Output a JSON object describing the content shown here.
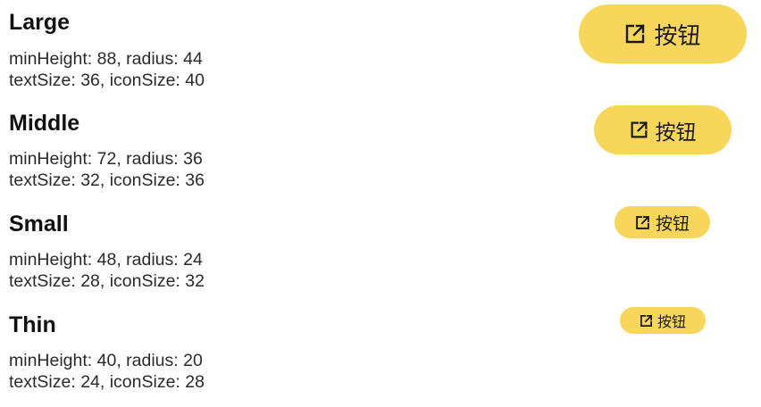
{
  "accent_color": "#F8D65A",
  "icon": "open-external-icon",
  "rows": [
    {
      "title": "Large",
      "spec_line1": "minHeight: 88, radius: 44",
      "spec_line2": "textSize: 36, iconSize: 40",
      "button_label": "按钮"
    },
    {
      "title": "Middle",
      "spec_line1": "minHeight: 72, radius: 36",
      "spec_line2": "textSize: 32, iconSize: 36",
      "button_label": "按钮"
    },
    {
      "title": "Small",
      "spec_line1": "minHeight: 48, radius: 24",
      "spec_line2": "textSize: 28, iconSize: 32",
      "button_label": "按钮"
    },
    {
      "title": "Thin",
      "spec_line1": "minHeight: 40, radius: 20",
      "spec_line2": "textSize: 24, iconSize: 28",
      "button_label": "按钮"
    }
  ]
}
